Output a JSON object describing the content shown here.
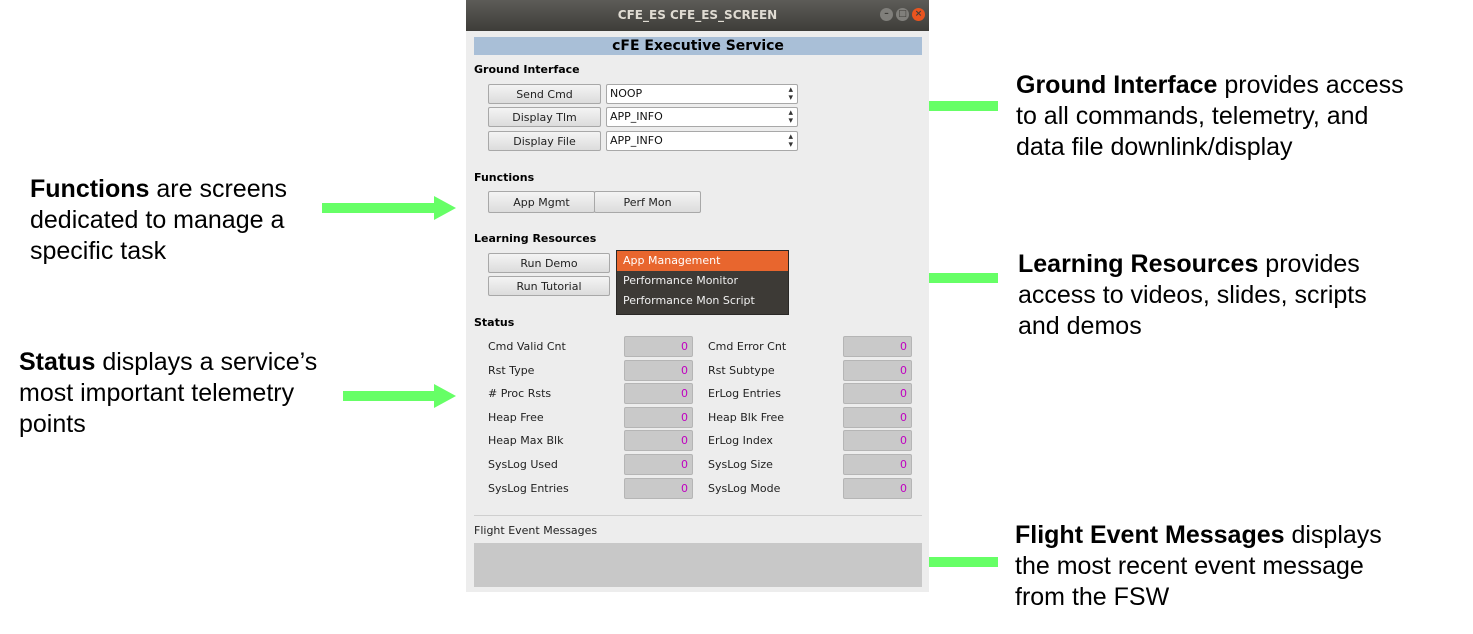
{
  "window": {
    "title": "CFE_ES CFE_ES_SCREEN",
    "header": "cFE Executive Service"
  },
  "ground_interface": {
    "label": "Ground Interface",
    "rows": [
      {
        "button": "Send Cmd",
        "value": "NOOP"
      },
      {
        "button": "Display Tlm",
        "value": "APP_INFO"
      },
      {
        "button": "Display File",
        "value": "APP_INFO"
      }
    ]
  },
  "functions": {
    "label": "Functions",
    "buttons": [
      "App Mgmt",
      "Perf Mon"
    ]
  },
  "learning_resources": {
    "label": "Learning Resources",
    "buttons": [
      "Run Demo",
      "Run Tutorial"
    ],
    "list": [
      "App Management",
      "Performance Monitor",
      "Performance Mon Script"
    ]
  },
  "status": {
    "label": "Status",
    "left": [
      {
        "name": "Cmd Valid Cnt",
        "value": "0"
      },
      {
        "name": "Rst Type",
        "value": "0"
      },
      {
        "name": "# Proc Rsts",
        "value": "0"
      },
      {
        "name": "Heap Free",
        "value": "0"
      },
      {
        "name": "Heap Max Blk",
        "value": "0"
      },
      {
        "name": "SysLog Used",
        "value": "0"
      },
      {
        "name": "SysLog Entries",
        "value": "0"
      }
    ],
    "right": [
      {
        "name": "Cmd Error Cnt",
        "value": "0"
      },
      {
        "name": "Rst Subtype",
        "value": "0"
      },
      {
        "name": "ErLog Entries",
        "value": "0"
      },
      {
        "name": "Heap Blk Free",
        "value": "0"
      },
      {
        "name": "ErLog Index",
        "value": "0"
      },
      {
        "name": "SysLog Size",
        "value": "0"
      },
      {
        "name": "SysLog Mode",
        "value": "0"
      }
    ]
  },
  "flight_events": {
    "label": "Flight Event Messages",
    "text": ""
  },
  "annotations": {
    "ground": {
      "bold": "Ground Interface",
      "rest": " provides access",
      "line2": "to all commands, telemetry, and",
      "line3": "data file downlink/display"
    },
    "functions": {
      "bold": "Functions",
      "rest": " are screens",
      "line2": "dedicated to manage a",
      "line3": "specific task"
    },
    "learning": {
      "bold": "Learning Resources",
      "rest": " provides",
      "line2": "access to videos, slides, scripts",
      "line3": "and demos"
    },
    "status": {
      "bold": "Status",
      "rest": " displays a service’s",
      "line2": "most important telemetry",
      "line3": "points"
    },
    "events": {
      "bold": "Flight Event Messages",
      "rest": " displays",
      "line2": "the most recent event message",
      "line3": "from the FSW"
    }
  },
  "colors": {
    "arrow": "#66ff66",
    "header_bg": "#a9bfd7",
    "selected": "#e8662e",
    "value_text": "#c000c0"
  }
}
